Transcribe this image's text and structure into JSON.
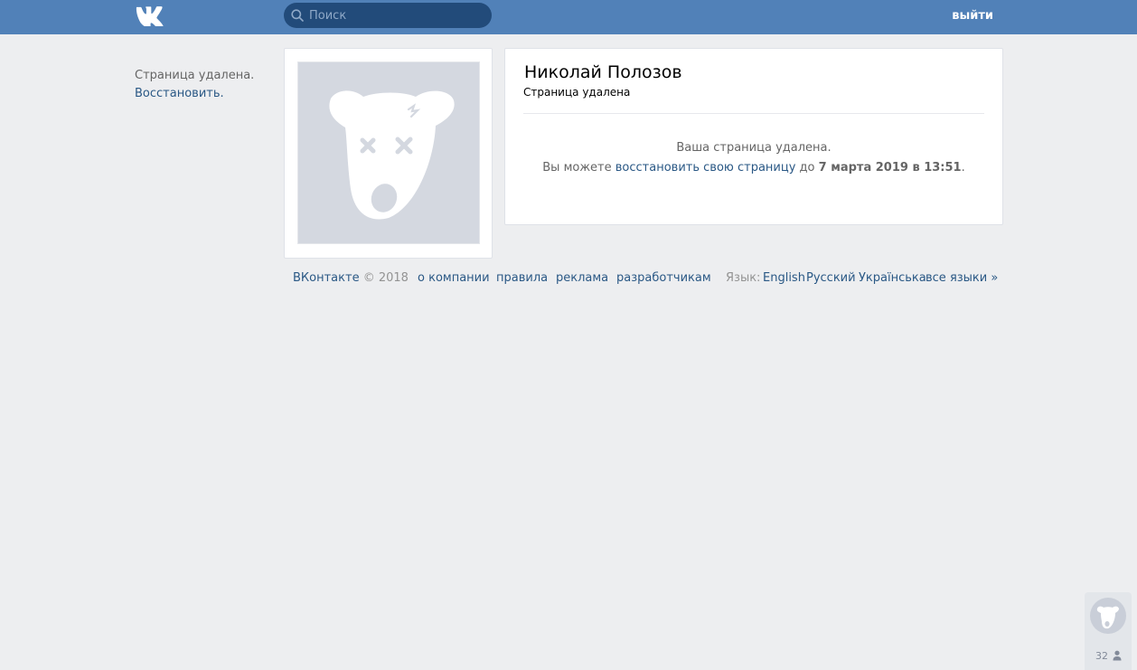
{
  "header": {
    "logo_text": "VK",
    "search_placeholder": "Поиск",
    "logout_label": "выйти"
  },
  "sidebar": {
    "notice": "Страница удалена.",
    "restore_link": "Восстановить."
  },
  "profile": {
    "name": "Николай Полозов",
    "status": "Страница удалена",
    "message_line1": "Ваша страница удалена.",
    "message_line2_prefix": "Вы можете ",
    "message_line2_link": "восстановить свою страницу",
    "message_line2_mid": " до ",
    "message_line2_date": "7 марта 2019 в 13:51",
    "message_line2_suffix": "."
  },
  "footer": {
    "brand": "ВКонтакте",
    "copyright": " © 2018",
    "links": [
      "о компании",
      "правила",
      "реклама",
      "разработчикам"
    ],
    "language_label": "Язык:",
    "languages": [
      "English",
      "Русский",
      "Українська",
      "все языки »"
    ]
  },
  "widget": {
    "count": "32"
  },
  "colors": {
    "header_bg": "#5181b8",
    "page_bg": "#edeef0",
    "link": "#2a5885",
    "search_bg": "#224b7a"
  }
}
